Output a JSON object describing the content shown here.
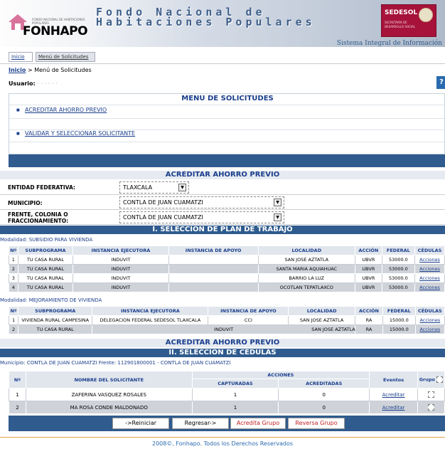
{
  "header": {
    "logo_text": "FONHAPO",
    "logo_small": "FONDO NACIONAL DE HABITACIONES POPULARES",
    "title_line1": "Fondo Nacional de",
    "title_line2": "Habitaciones Populares",
    "sedesol_name": "SEDESOL",
    "sedesol_sub": "SECRETARÍA DE DESARROLLO SOCIAL",
    "system_name": "Sistema Integral de Información"
  },
  "tabs": [
    "Inicio",
    "Menú de Solicitudes"
  ],
  "breadcrumb": {
    "home": "Inicio",
    "sep": ">",
    "current": "Menú de Solicitudes"
  },
  "user": {
    "label": "Usuario:",
    "value": "· ·  ·  ·  ·  ·"
  },
  "help_label": "?",
  "menu": {
    "title": "MENU DE SOLICITUDES",
    "items": [
      "ACREDITAR AHORRO PREVIO",
      "VALIDAR Y SELECCIONAR SOLICITANTE"
    ]
  },
  "acreditar": {
    "title": "ACREDITAR AHORRO PREVIO",
    "entidad_label": "ENTIDAD FEDERATIVA:",
    "entidad_value": "TLAXCALA",
    "municipio_label": "MUNICIPIO:",
    "municipio_value": "CONTLA DE JUAN CUAMATZI",
    "frente_label_1": "FRENTE, COLONIA O",
    "frente_label_2": "FRACCIONAMIENTO:",
    "frente_value": "CONTLA DE JUAN CUAMATZI"
  },
  "plan": {
    "title": "I. SELECCIÓN DE PLAN DE TRABAJO",
    "mod1_label": "Modalidad: SUBSIDIO PARA VIVIENDA",
    "mod1_headers": [
      "Nº",
      "SUBPROGRAMA",
      "INSTANCIA EJECUTORA",
      "INSTANCIA DE APOYO",
      "LOCALIDAD",
      "ACCIÓN",
      "FEDERAL",
      "CÉDULAS"
    ],
    "mod1_rows": [
      [
        "1",
        "TU CASA RURAL",
        "INDUVIT",
        "",
        "SAN JOSE AZTATLA",
        "UBVR",
        "53000.0",
        "Acciones"
      ],
      [
        "2",
        "TU CASA RURAL",
        "INDUVIT",
        "",
        "SANTA MARIA AQUIAHUAC",
        "UBVR",
        "53000.0",
        "Acciones"
      ],
      [
        "3",
        "TU CASA RURAL",
        "INDUVIT",
        "",
        "BARRIO LA LUZ",
        "UBVR",
        "53000.0",
        "Acciones"
      ],
      [
        "4",
        "TU CASA RURAL",
        "INDUVIT",
        "",
        "OCOTLAN TEPATLAXCO",
        "UBVR",
        "53000.0",
        "Acciones"
      ]
    ],
    "mod2_label": "Modalidad: MEJORAMIENTO DE VIVIENDA",
    "mod2_headers": [
      "Nº",
      "SUBPROGRAMA",
      "INSTANCIA EJECUTORA",
      "INSTANCIA DE APOYO",
      "LOCALIDAD",
      "ACCIÓN",
      "FEDERAL",
      "CÉDULAS"
    ],
    "mod2_rows": [
      [
        "1",
        "VIVIENDA RURAL CAMPESINA",
        "DELEGACION FEDERAL SEDESOL TLAXCALA",
        "CCI",
        "SAN JOSE AZTATLA",
        "RA",
        "15000.0",
        "Acciones"
      ],
      [
        "2",
        "TU CASA RURAL",
        "INDUVIT",
        "",
        "SAN JOSE AZTATLA",
        "RA",
        "15000.0",
        "Acciones"
      ]
    ]
  },
  "cedulas": {
    "title1": "ACREDITAR AHORRO PREVIO",
    "title2": "II. SELECCIÓN DE CÉDULAS",
    "municipio_line": "Municipio: CONTLA DE JUAN CUAMATZI Frente: 112901800001 - CONTLA DE JUAN CUAMATZI",
    "h_no": "Nº",
    "h_nombre": "NOMBRE DEL SOLICITANTE",
    "h_acciones": "ACCIONES",
    "h_capturadas": "CAPTURADAS",
    "h_acreditadas": "ACREDITADAS",
    "h_eventos": "Eventos",
    "h_grupo": "Grupo",
    "rows": [
      {
        "no": "1",
        "nombre": "ZAFERINA VASQUEZ ROSALES",
        "capturadas": "1",
        "acreditadas": "0",
        "evento": "Acreditar"
      },
      {
        "no": "2",
        "nombre": "MA ROSA CONDE MALDONADO",
        "capturadas": "1",
        "acreditadas": "0",
        "evento": "Acreditar"
      }
    ]
  },
  "buttons": {
    "reiniciar": "->Reiniciar",
    "regresar": "Regresar->",
    "acredita_grupo": "Acredita Grupo",
    "reversa_grupo": "Reversa Grupo"
  },
  "footer": {
    "copyright": "2008©, Fonhapo. Todos los Derechos Reservados"
  },
  "colors": {
    "navy": "#2f5b8e",
    "link": "#1a3e8c",
    "sedesol": "#a6123a"
  }
}
